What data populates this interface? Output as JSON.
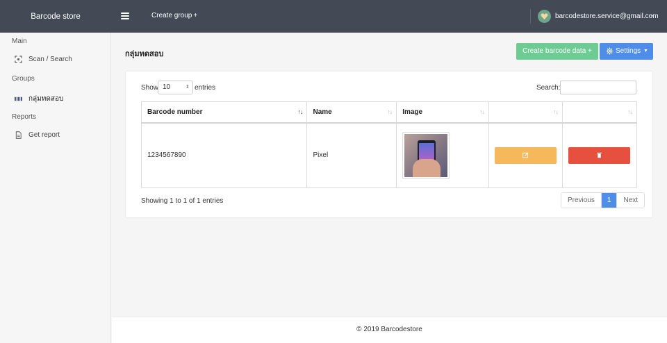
{
  "topbar": {
    "brand": "Barcode store",
    "create_group": "Create group",
    "create_group_plus": "+",
    "user_email": "barcodestore.service@gmail.com"
  },
  "sidebar": {
    "main_heading": "Main",
    "scan_search": "Scan / Search",
    "groups_heading": "Groups",
    "group_item": "กลุ่มทดสอบ",
    "reports_heading": "Reports",
    "get_report": "Get report"
  },
  "main": {
    "page_title": "กลุ่มทดสอบ",
    "create_button": "Create barcode data  +",
    "settings_button": "Settings"
  },
  "table_controls": {
    "show": "Show",
    "page_size": "10",
    "entries": "entries",
    "search_label": "Search:",
    "search_value": ""
  },
  "table": {
    "columns": [
      "Barcode number",
      "Name",
      "Image",
      "",
      ""
    ],
    "rows": [
      {
        "barcode": "1234567890",
        "name": "Pixel"
      }
    ]
  },
  "pagination": {
    "info": "Showing 1 to 1 of 1 entries",
    "previous": "Previous",
    "current": "1",
    "next": "Next"
  },
  "footer": {
    "text": "© 2019 Barcodestore"
  },
  "colors": {
    "topbar": "#434a56",
    "create_button": "#6ecb94",
    "settings_button": "#4f8ee8",
    "edit_button": "#f5b85b",
    "delete_button": "#e5503f",
    "active_page": "#4f8ee8"
  }
}
